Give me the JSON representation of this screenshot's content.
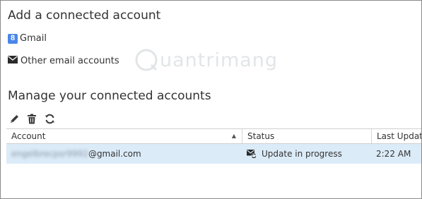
{
  "add_section": {
    "title": "Add a connected account",
    "gmail_label": "Gmail",
    "gmail_badge": "8",
    "other_label": "Other email accounts"
  },
  "manage_section": {
    "title": "Manage your connected accounts",
    "toolbar": {
      "icons": [
        "pencil-icon",
        "trash-icon",
        "refresh-icon"
      ]
    }
  },
  "grid": {
    "columns": [
      "Account",
      "Status",
      "Last Update"
    ],
    "sort_indicator": "▲",
    "rows": [
      {
        "account_blurred": "engelbrecpsr9992",
        "account_domain": "@gmail.com",
        "status": "Update in progress",
        "last_update": "2:22 AM"
      }
    ]
  },
  "watermark": {
    "text": "uantrimang"
  },
  "colors": {
    "selected_row": "#dcebf8",
    "gmail_badge": "#4a86e8",
    "text": "#333333",
    "border": "#cfcfcf"
  }
}
